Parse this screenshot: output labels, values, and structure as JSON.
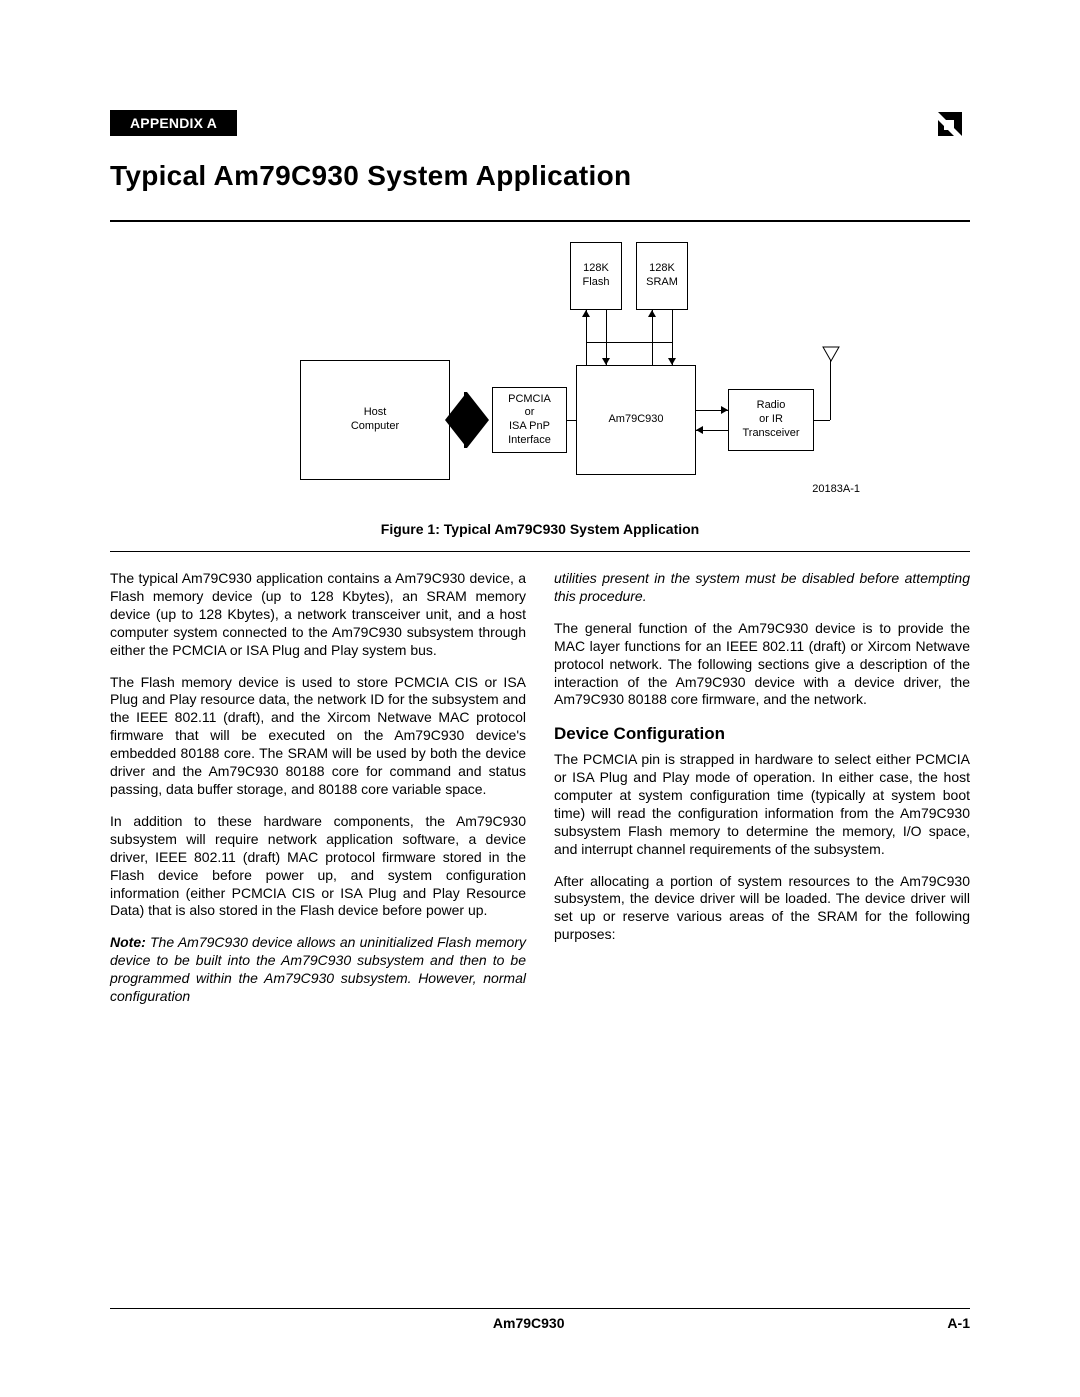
{
  "header": {
    "appendix_label": "APPENDIX A",
    "title": "Typical Am79C930 System Application"
  },
  "diagram": {
    "blocks": {
      "flash": {
        "line1": "128K",
        "line2": "Flash"
      },
      "sram": {
        "line1": "128K",
        "line2": "SRAM"
      },
      "host": {
        "line1": "Host",
        "line2": "Computer"
      },
      "iface": {
        "line1": "PCMCIA",
        "line2": "or",
        "line3": "ISA PnP",
        "line4": "Interface"
      },
      "core": {
        "line1": "Am79C930"
      },
      "radio": {
        "line1": "Radio",
        "line2": "or IR",
        "line3": "Transceiver"
      }
    },
    "figure_id": "20183A-1",
    "caption": "Figure 1: Typical Am79C930 System Application"
  },
  "body": {
    "left": {
      "p1": "The typical Am79C930 application contains a Am79C930 device, a Flash memory device (up to 128 Kbytes), an SRAM memory device (up to 128 Kbytes), a network transceiver unit, and a host computer system connected to the Am79C930 subsystem through either the PCMCIA or ISA Plug and Play system bus.",
      "p2": "The Flash memory device is used to store PCMCIA CIS or ISA Plug and Play resource data, the network ID for the subsystem and the IEEE 802.11 (draft), and the Xircom Netwave MAC protocol firmware that will be executed on the Am79C930 device's embedded 80188 core. The SRAM will be used by both the device driver and the Am79C930 80188 core for command and status passing, data buffer storage, and 80188 core variable space.",
      "p3": "In addition to these hardware components, the Am79C930 subsystem will require network application software, a device driver, IEEE 802.11 (draft) MAC protocol firmware stored in the Flash device before power up, and system configuration information (either PCMCIA CIS or ISA Plug and Play Resource Data) that is also stored in the Flash device before power up.",
      "note_label": "Note:",
      "note": "The Am79C930 device allows an uninitialized Flash memory device to be built into the Am79C930 subsystem and then to be programmed within the Am79C930 subsystem. However, normal configuration"
    },
    "right": {
      "note_cont": "utilities present in the system must be disabled before attempting this procedure.",
      "p1": "The general function of the Am79C930 device is to provide the MAC layer functions for an IEEE 802.11 (draft) or Xircom Netwave protocol network. The following sections give a description of the interaction of the Am79C930 device with a device driver, the Am79C930 80188 core firmware, and the network.",
      "subhead": "Device Configuration",
      "p2": "The PCMCIA pin is strapped in hardware to select either PCMCIA or ISA Plug and Play mode of operation. In either case, the host computer at system configuration time (typically at system boot time) will read the configuration information from the Am79C930 subsystem Flash memory to determine the memory, I/O space, and interrupt channel requirements of the subsystem.",
      "p3": "After allocating a portion of system resources to the Am79C930 subsystem, the device driver will be loaded. The device driver will set up or reserve various areas of the SRAM for the following purposes:"
    }
  },
  "footer": {
    "center": "Am79C930",
    "page": "A-1"
  }
}
